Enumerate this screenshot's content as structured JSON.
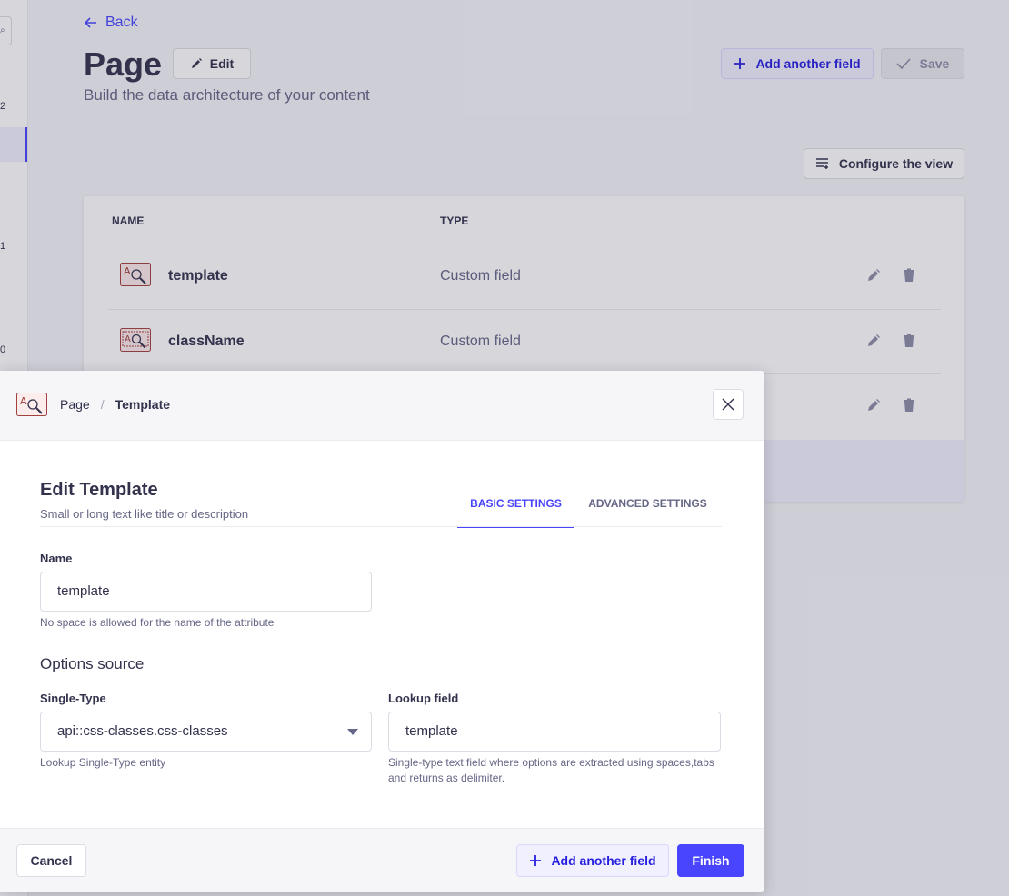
{
  "header": {
    "back_label": "Back",
    "title": "Page",
    "edit_label": "Edit",
    "subtitle": "Build the data architecture of your content",
    "add_field_label": "Add another field",
    "save_label": "Save",
    "configure_label": "Configure the view"
  },
  "sidebar": {
    "counts": [
      "2",
      "1",
      "0"
    ]
  },
  "table": {
    "columns": [
      "NAME",
      "TYPE"
    ],
    "rows": [
      {
        "name": "template",
        "type": "Custom field"
      },
      {
        "name": "className",
        "type": "Custom field"
      },
      {
        "name": "",
        "type": ""
      }
    ]
  },
  "modal": {
    "breadcrumb": {
      "parent": "Page",
      "separator": "/",
      "current": "Template"
    },
    "title": "Edit Template",
    "subtitle": "Small or long text like title or description",
    "tabs": [
      "BASIC SETTINGS",
      "ADVANCED SETTINGS"
    ],
    "name_label": "Name",
    "name_value": "template",
    "name_hint": "No space is allowed for the name of the attribute",
    "options_section": "Options source",
    "single_type_label": "Single-Type",
    "single_type_value": "api::css-classes.css-classes",
    "single_type_hint": "Lookup Single-Type entity",
    "lookup_label": "Lookup field",
    "lookup_value": "template",
    "lookup_hint": "Single-type text field where options are extracted using spaces,tabs and returns as delimiter.",
    "cancel_label": "Cancel",
    "add_field_label": "Add another field",
    "finish_label": "Finish"
  },
  "colors": {
    "primary": "#4945ff",
    "primary_light": "#f0f0ff",
    "text": "#32324d",
    "muted": "#666687"
  }
}
